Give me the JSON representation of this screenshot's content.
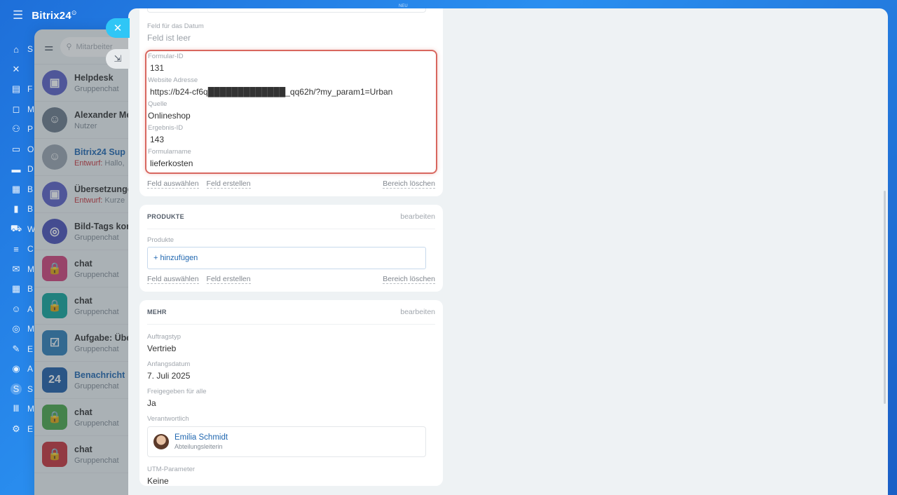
{
  "app": {
    "brand": "Bitrix24",
    "brand_sup": "⊙",
    "neu_label": "NEU"
  },
  "nav": [
    {
      "icon": "home-icon",
      "glyph": "⌂",
      "letter": "S"
    },
    {
      "icon": "close-icon",
      "glyph": "✕",
      "letter": ""
    },
    {
      "icon": "feed-icon",
      "glyph": "▤",
      "letter": "F"
    },
    {
      "icon": "messenger-icon",
      "glyph": "◻",
      "letter": "M"
    },
    {
      "icon": "people-icon",
      "glyph": "⚇",
      "letter": "P"
    },
    {
      "icon": "document-icon",
      "glyph": "▭",
      "letter": "O"
    },
    {
      "icon": "drive-icon",
      "glyph": "▬",
      "letter": "D"
    },
    {
      "icon": "board-icon",
      "glyph": "▦",
      "letter": "B"
    },
    {
      "icon": "analytics-icon",
      "glyph": "▮",
      "letter": "B"
    },
    {
      "icon": "cart-icon",
      "glyph": "⛟",
      "letter": "W"
    },
    {
      "icon": "funnel-icon",
      "glyph": "≡",
      "letter": "C"
    },
    {
      "icon": "mail-icon",
      "glyph": "✉",
      "letter": "M"
    },
    {
      "icon": "calendar-icon",
      "glyph": "▦",
      "letter": "B"
    },
    {
      "icon": "robot-icon",
      "glyph": "☺",
      "letter": "A"
    },
    {
      "icon": "target-icon",
      "glyph": "◎",
      "letter": "M"
    },
    {
      "icon": "sign-icon",
      "glyph": "✎",
      "letter": "E"
    },
    {
      "icon": "support-icon",
      "glyph": "◉",
      "letter": "A"
    },
    {
      "icon": "badge-icon",
      "glyph": "S",
      "letter": "S"
    },
    {
      "icon": "market-icon",
      "glyph": "Ⅲ",
      "letter": "M"
    },
    {
      "icon": "settings-icon",
      "glyph": "⚙",
      "letter": "E"
    }
  ],
  "chat_search": {
    "placeholder": "Mitarbeiter"
  },
  "chats": [
    {
      "name": "Helpdesk",
      "sub": "Gruppenchat",
      "draft": "",
      "color": "#5b5fc7",
      "glyph": "▣",
      "blue": false
    },
    {
      "name": "Alexander Mei",
      "sub": "Nutzer",
      "draft": "",
      "color": "#6b7a8a",
      "glyph": "☺",
      "blue": false
    },
    {
      "name": "Bitrix24 Sup",
      "sub": "Hallo,",
      "draft": "Entwurf:",
      "color": "#9aa4ae",
      "glyph": "☺",
      "blue": true
    },
    {
      "name": "Übersetzunge",
      "sub": "Kurze",
      "draft": "Entwurf:",
      "color": "#5b5fc7",
      "glyph": "▣",
      "blue": false
    },
    {
      "name": "Bild-Tags korri",
      "sub": "Gruppenchat",
      "draft": "",
      "color": "#4a4fb8",
      "glyph": "◎",
      "blue": false
    },
    {
      "name": "chat",
      "sub": "Gruppenchat",
      "draft": "",
      "color": "#d0417a",
      "glyph": "🔒",
      "blue": false
    },
    {
      "name": "chat",
      "sub": "Gruppenchat",
      "draft": "",
      "color": "#11a59c",
      "glyph": "🔒",
      "blue": false
    },
    {
      "name": "Aufgabe: Über",
      "sub": "Gruppenchat",
      "draft": "",
      "color": "#2e7fb9",
      "glyph": "☑",
      "blue": false
    },
    {
      "name": "Benachricht",
      "sub": "Gruppenchat",
      "draft": "",
      "color": "#1f5ea8",
      "glyph": "24",
      "blue": true
    },
    {
      "name": "chat",
      "sub": "Gruppenchat",
      "draft": "",
      "color": "#4aa64a",
      "glyph": "🔒",
      "blue": false
    },
    {
      "name": "chat",
      "sub": "Gruppenchat",
      "draft": "",
      "color": "#c7333a",
      "glyph": "🔒",
      "blue": false
    }
  ],
  "form": {
    "date_field": {
      "label": "Feld für das Datum",
      "value": "Feld ist leer"
    },
    "highlighted": [
      {
        "label": "Formular-ID",
        "value": "131"
      },
      {
        "label": "Website Adresse",
        "value": "https://b24-cf6q█████████████_qq62h/?my_param1=Urban"
      },
      {
        "label": "Quelle",
        "value": "Onlineshop"
      },
      {
        "label": "Ergebnis-ID",
        "value": "143"
      },
      {
        "label": "Formularname",
        "value": "lieferkosten"
      }
    ],
    "actions": {
      "select": "Feld auswählen",
      "create": "Feld erstellen",
      "clear": "Bereich löschen"
    }
  },
  "products": {
    "title": "PRODUKTE",
    "edit": "bearbeiten",
    "field_label": "Produkte",
    "add": "+ hinzufügen"
  },
  "more": {
    "title": "MEHR",
    "edit": "bearbeiten",
    "fields": [
      {
        "label": "Auftragstyp",
        "value": "Vertrieb"
      },
      {
        "label": "Anfangsdatum",
        "value": "7. Juli 2025"
      },
      {
        "label": "Freigegeben für alle",
        "value": "Ja"
      }
    ],
    "responsible_label": "Verantwortlich",
    "responsible_name": "Emilia Schmidt",
    "responsible_role": "Abteilungsleiterin",
    "utm_label": "UTM-Parameter",
    "utm_value": "Keine"
  }
}
